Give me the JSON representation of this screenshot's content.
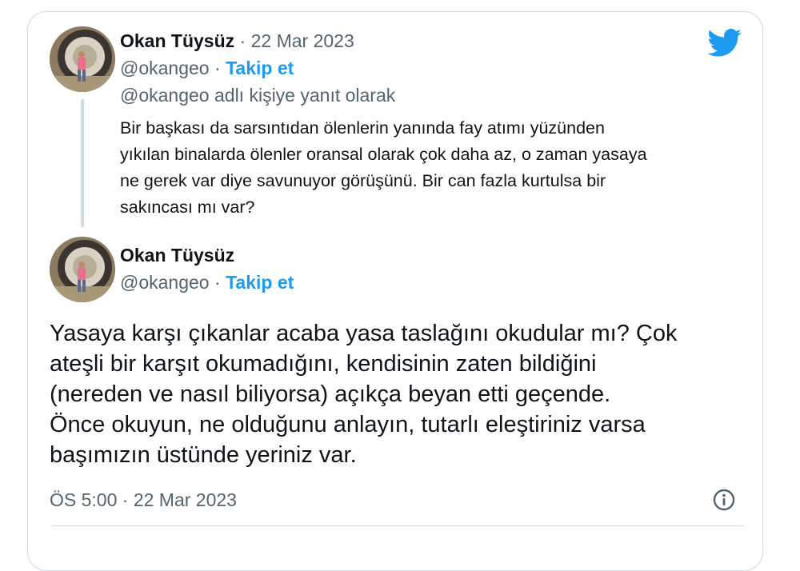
{
  "reply_tweet": {
    "author_name": "Okan Tüysüz",
    "separator": " · ",
    "date": "22 Mar 2023",
    "handle": "@okangeo",
    "follow_label": "Takip et",
    "reply_context": "@okangeo adlı kişiye yanıt olarak",
    "text_lines": [
      "Bir başkası da sarsıntıdan ölenlerin yanında fay atımı yüzünden",
      "yıkılan binalarda ölenler oransal olarak çok daha az, o zaman yasaya",
      "ne gerek var diye savunuyor görüşünü. Bir can fazla kurtulsa bir",
      "sakıncası mı var?"
    ]
  },
  "main_tweet": {
    "author_name": "Okan Tüysüz",
    "handle": "@okangeo",
    "follow_label": "Takip et",
    "text_lines": [
      "Yasaya karşı çıkanlar acaba yasa taslağını okudular mı? Çok",
      "ateşli bir karşıt okumadığını, kendisinin zaten bildiğini",
      "(nereden ve nasıl biliyorsa) açıkça beyan etti geçende.",
      "Önce okuyun,  ne olduğunu anlayın, tutarlı eleştiriniz varsa",
      "başımızın üstünde yeriniz var."
    ],
    "timestamp": "ÖS 5:00 · 22 Mar 2023"
  },
  "icons": {
    "brand": "twitter-bird-icon",
    "info": "info-icon"
  },
  "colors": {
    "accent": "#1d9bf0",
    "text": "#0f1419",
    "muted": "#536471",
    "border": "#cfd9de"
  }
}
